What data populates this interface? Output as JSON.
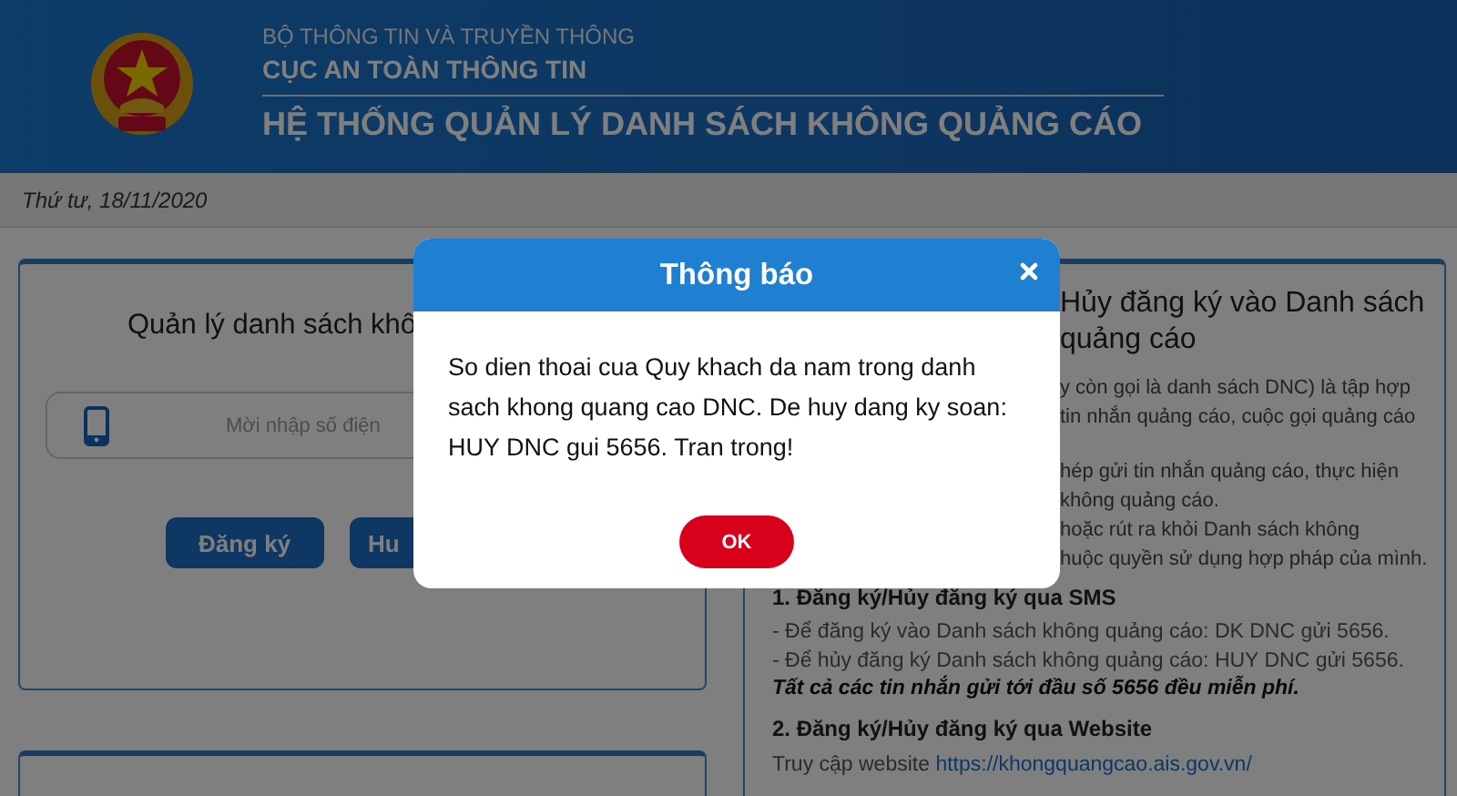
{
  "header": {
    "ministry": "BỘ THÔNG TIN VÀ TRUYỀN THÔNG",
    "agency": "CỤC AN TOÀN THÔNG TIN",
    "system_title": "HỆ THỐNG QUẢN LÝ DANH SÁCH KHÔNG QUẢNG CÁO"
  },
  "date": "Thứ tư, 18/11/2020",
  "left_card": {
    "title": "Quản lý danh sách khô",
    "phone_field": {
      "placeholder": "Mời nhập số điện"
    },
    "buttons": [
      "Đăng ký",
      "Hu"
    ]
  },
  "right_card": {
    "title_lines": [
      "Hủy đăng ký vào Danh sách",
      "quảng cáo"
    ],
    "paragraphs": [
      [
        "y còn gọi là danh sách DNC) là tập hợp",
        "tin nhắn quảng cáo, cuộc gọi quảng cáo"
      ],
      [
        "hép gửi tin nhắn quảng cáo, thực hiện",
        "không quảng cáo.",
        "hoặc rút ra khỏi Danh sách không",
        "huộc quyền sử dụng hợp pháp của mình."
      ]
    ],
    "sections": [
      {
        "heading": "1. Đăng ký/Hủy đăng ký qua SMS",
        "lines": [
          {
            "text": "- Để đăng ký vào Danh sách không quảng cáo: DK DNC gửi 5656.",
            "emphasis": false
          },
          {
            "text": "- Để hủy đăng ký Danh sách không quảng cáo: HUY DNC gửi 5656.",
            "emphasis": false
          },
          {
            "text": "Tất cả các tin nhắn gửi tới đầu số 5656 đều miễn phí.",
            "emphasis": true
          }
        ]
      },
      {
        "heading": "2. Đăng ký/Hủy đăng ký qua Website",
        "website": {
          "prefix": "Truy cập website",
          "link": "https://khongquangcao.ais.gov.vn/"
        }
      }
    ]
  },
  "modal": {
    "title": "Thông báo",
    "message": "So dien thoai cua Quy khach da nam trong danh sach khong quang cao DNC. De huy dang ky soan: HUY DNC gui 5656. Tran trong!",
    "ok_button": "OK"
  }
}
